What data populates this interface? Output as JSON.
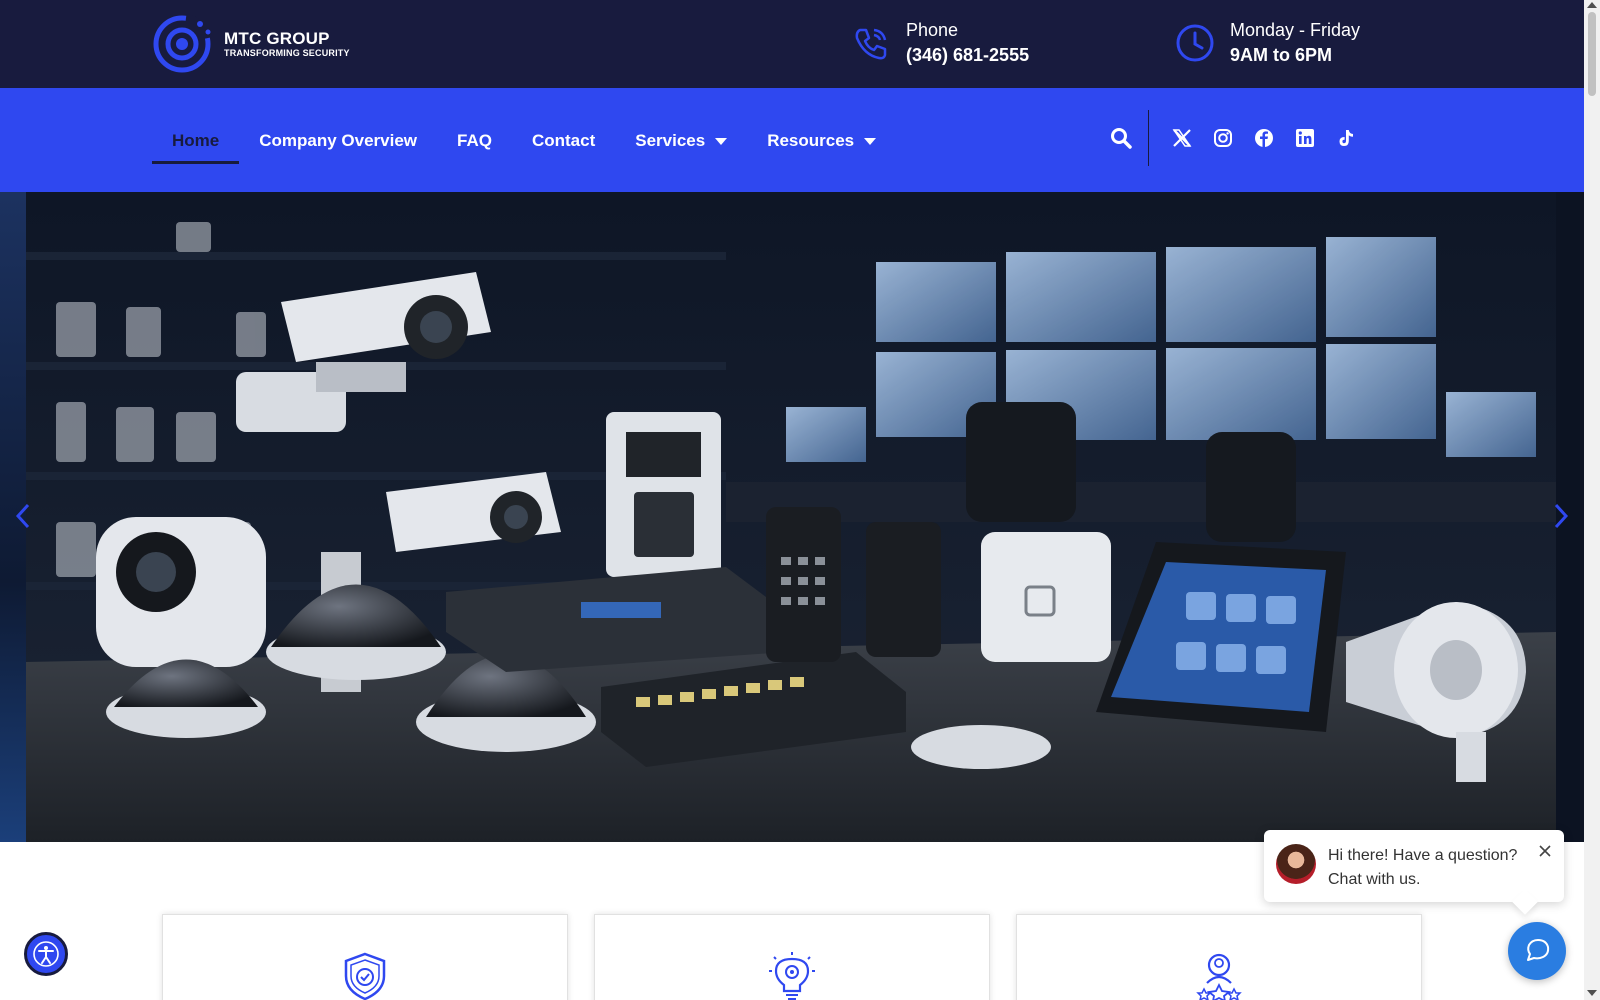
{
  "brand": {
    "name": "MTC GROUP",
    "tagline": "TRANSFORMING SECURITY"
  },
  "contact": {
    "phone_label": "Phone",
    "phone_number": "(346) 681-2555",
    "hours_label": "Monday - Friday",
    "hours_value": "9AM to 6PM"
  },
  "nav": {
    "items": [
      {
        "label": "Home",
        "active": true
      },
      {
        "label": "Company Overview"
      },
      {
        "label": "FAQ"
      },
      {
        "label": "Contact"
      },
      {
        "label": "Services",
        "has_dropdown": true
      },
      {
        "label": "Resources",
        "has_dropdown": true
      }
    ],
    "social_icons": [
      "x-icon",
      "instagram-icon",
      "facebook-icon",
      "linkedin-icon",
      "tiktok-icon"
    ]
  },
  "chat": {
    "greeting_line1": "Hi there! Have a question?",
    "greeting_line2": "Chat with us."
  },
  "colors": {
    "topbar": "#181b3e",
    "nav": "#2f48f0",
    "chat": "#2a7de1"
  },
  "cards": [
    "shield-check-icon",
    "lightbulb-gear-icon",
    "award-person-icon"
  ]
}
